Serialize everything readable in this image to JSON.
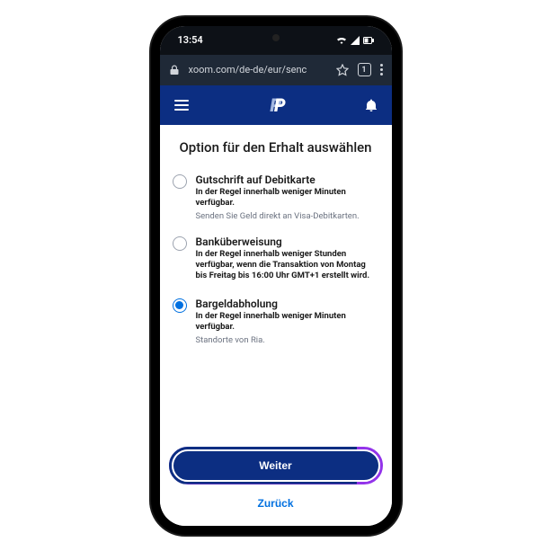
{
  "status": {
    "time": "13:54",
    "tab_count": "1"
  },
  "browser": {
    "url": "xoom.com/de-de/eur/senc"
  },
  "page": {
    "title": "Option für den Erhalt auswählen"
  },
  "options": [
    {
      "title": "Gutschrift auf Debitkarte",
      "subtitle": "In der Regel innerhalb weniger Minuten verfügbar.",
      "note": "Senden Sie Geld direkt an Visa-Debitkarten.",
      "selected": false
    },
    {
      "title": "Banküberweisung",
      "subtitle": "In der Regel innerhalb weniger Stunden verfügbar, wenn die Transaktion von Montag bis Freitag bis 16:00 Uhr GMT+1 erstellt wird.",
      "note": "",
      "selected": false
    },
    {
      "title": "Bargeldabholung",
      "subtitle": "In der Regel innerhalb weniger Minuten verfügbar.",
      "note": "Standorte von Ria.",
      "selected": true
    }
  ],
  "buttons": {
    "continue": "Weiter",
    "back": "Zurück"
  }
}
